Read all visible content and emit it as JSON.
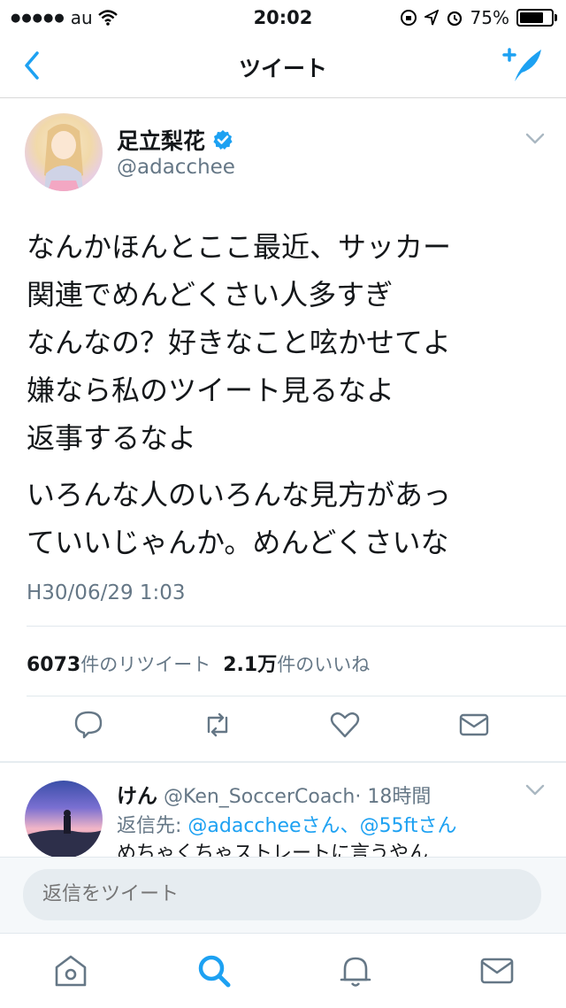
{
  "status_bar": {
    "carrier": "au",
    "time": "20:02",
    "battery": "75%"
  },
  "nav": {
    "title": "ツイート"
  },
  "tweet": {
    "author_name": "足立梨花",
    "author_handle": "@adacchee",
    "body_lines": [
      "なんかほんとここ最近、サッカー",
      "関連でめんどくさい人多すぎ",
      "なんなの？好きなこと呟かせてよ",
      "嫌なら私のツイート見るなよ",
      "返事するなよ"
    ],
    "body_lines_2": [
      "いろんな人のいろんな見方があっ",
      "ていいじゃんか。めんどくさいな"
    ],
    "timestamp": "H30/06/29 1:03",
    "retweet_count": "6073",
    "retweet_label": "件のリツイート",
    "like_count": "2.1万",
    "like_label": "件のいいね"
  },
  "reply": {
    "name": "けん",
    "handle": "@Ken_SoccerCoach",
    "time": "· 18時間",
    "reply_to_prefix": "返信先: ",
    "reply_to_1": "@adacchee",
    "reply_to_sep": "さん、",
    "reply_to_2": "@55ft",
    "reply_to_suffix": "さん",
    "text": "めちゃくちゃストレートに言うやん"
  },
  "composer": {
    "placeholder": "返信をツイート"
  },
  "colors": {
    "accent": "#1da1f2",
    "verified": "#1da1f2",
    "muted": "#657786"
  }
}
